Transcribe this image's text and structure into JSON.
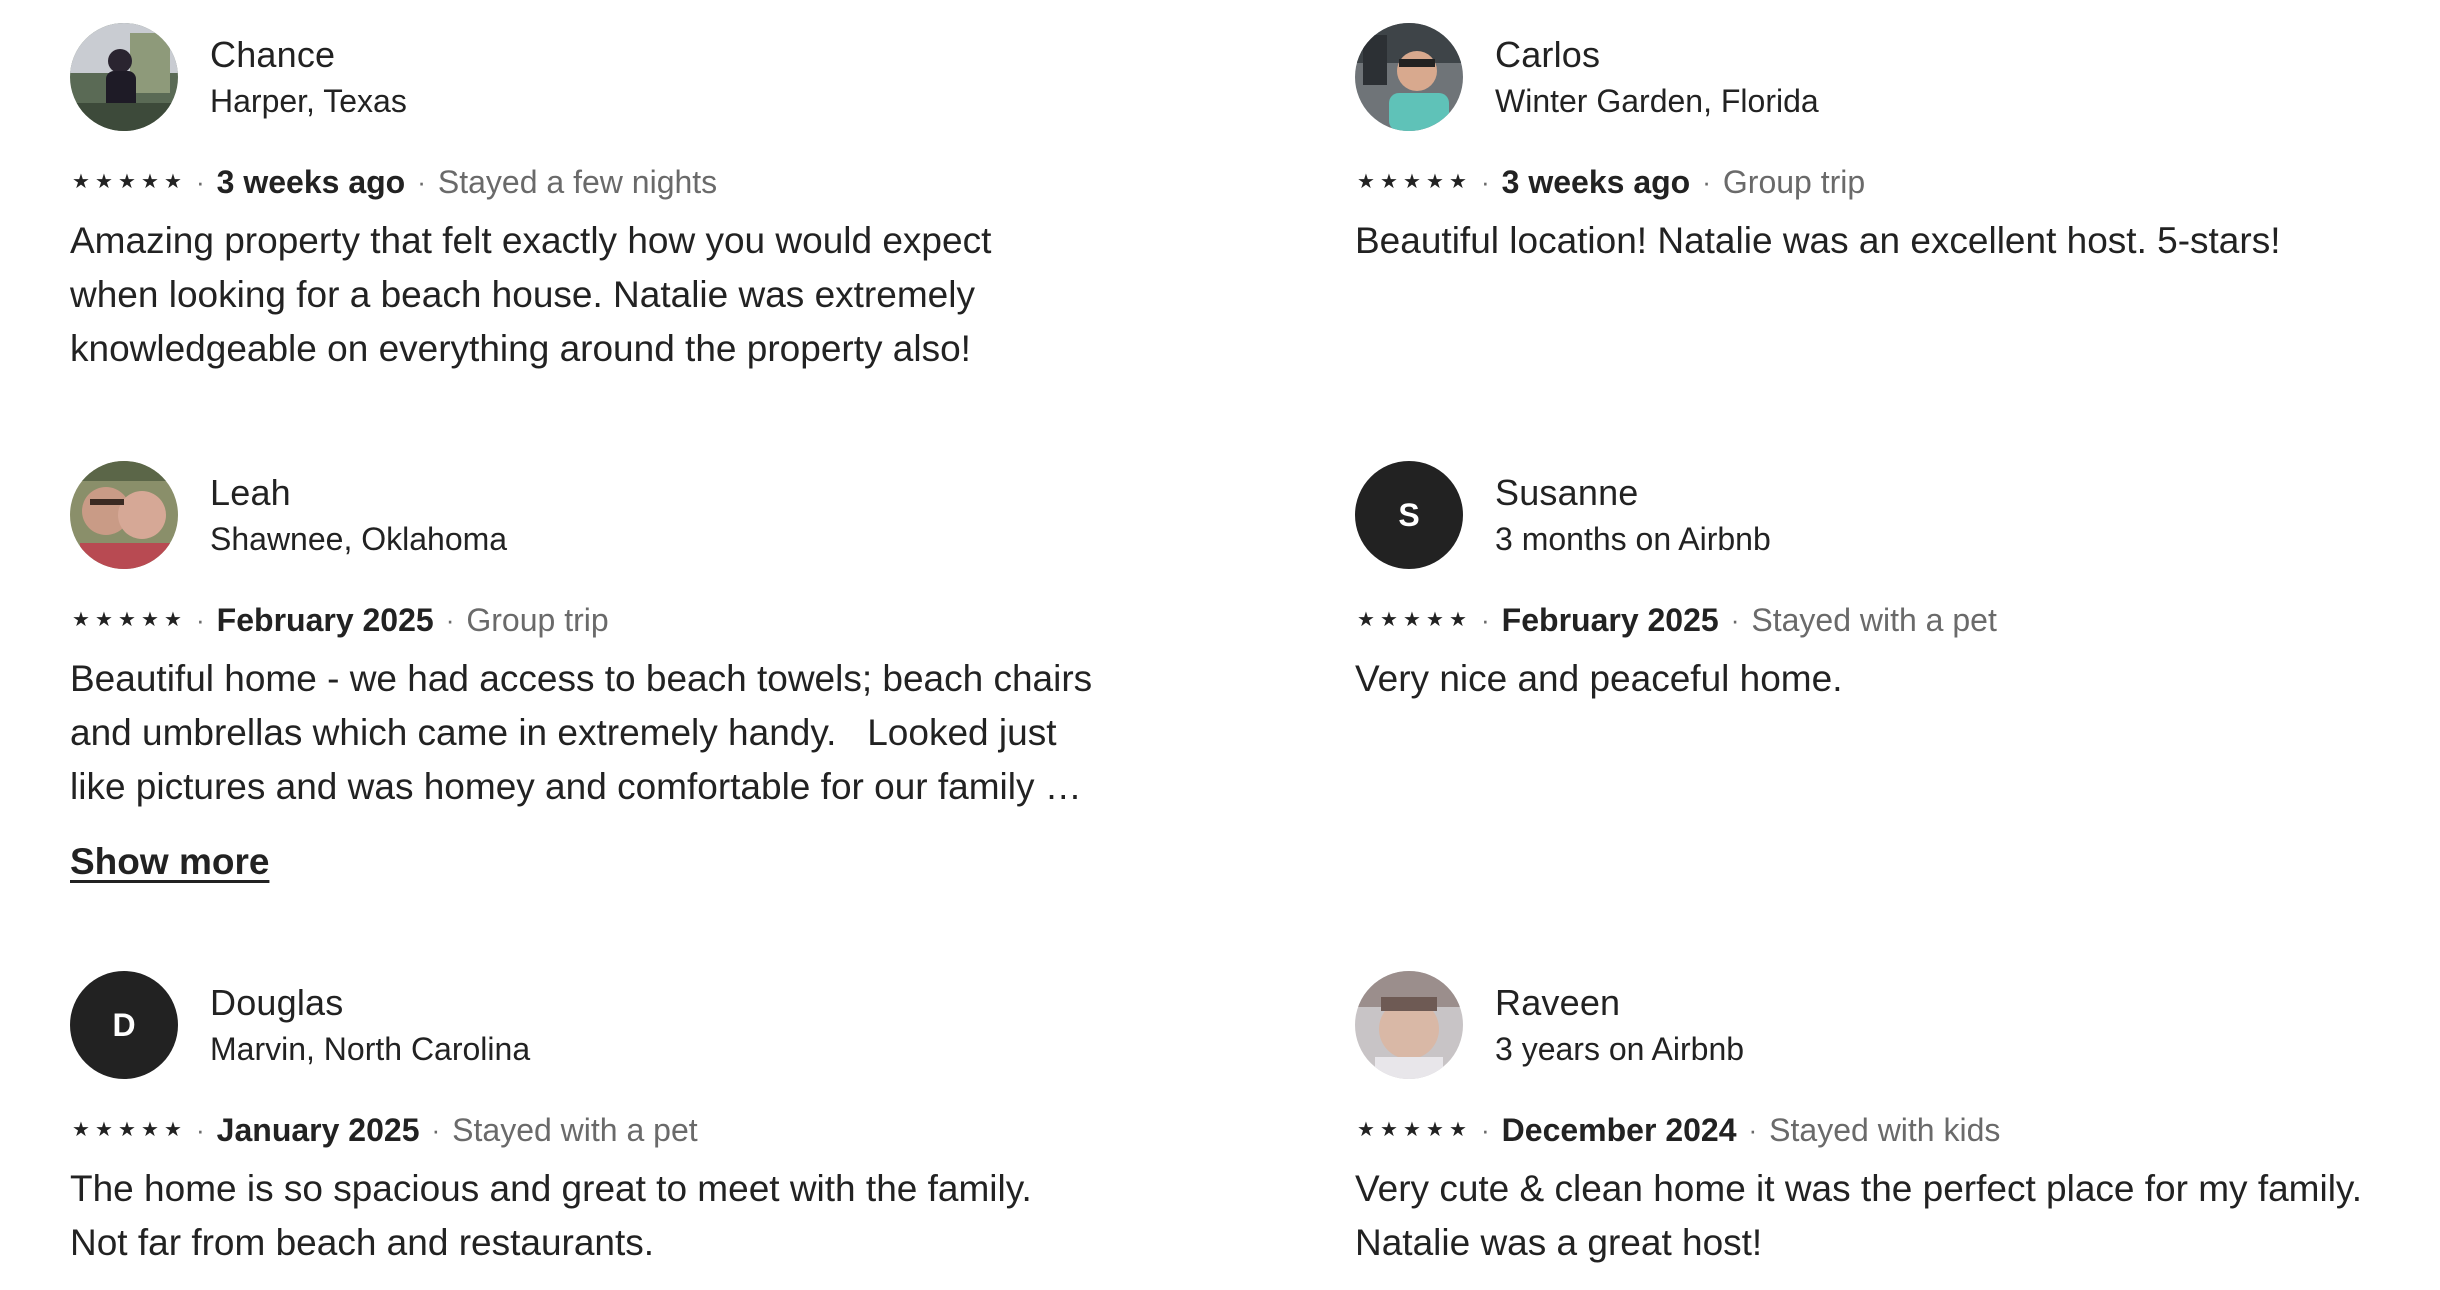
{
  "reviews": [
    {
      "name": "Chance",
      "location": "Harper, Texas",
      "rating": 5,
      "date": "3 weeks ago",
      "trip_type": "Stayed a few nights",
      "text": "Amazing property that felt exactly how you would expect\nwhen looking for a beach house. Natalie was extremely\nknowledgeable on everything around the property also!",
      "avatar": "photo-avatar"
    },
    {
      "name": "Carlos",
      "location": "Winter Garden, Florida",
      "rating": 5,
      "date": "3 weeks ago",
      "trip_type": "Group trip",
      "text": "Beautiful location! Natalie was an excellent host. 5-stars!",
      "avatar": "photo-avatar"
    },
    {
      "name": "Leah",
      "location": "Shawnee, Oklahoma",
      "rating": 5,
      "date": "February 2025",
      "trip_type": "Group trip",
      "text": "Beautiful home - we had access to beach towels; beach chairs\nand umbrellas which came in extremely handy.   Looked just\nlike pictures and was homey and comfortable for our family …",
      "show_more": "Show more",
      "avatar": "photo-avatar"
    },
    {
      "name": "Susanne",
      "location": "3 months on Airbnb",
      "rating": 5,
      "date": "February 2025",
      "trip_type": "Stayed with a pet",
      "text": "Very nice and peaceful home.",
      "avatar_letter": "S"
    },
    {
      "name": "Douglas",
      "location": "Marvin, North Carolina",
      "rating": 5,
      "date": "January 2025",
      "trip_type": "Stayed with a pet",
      "text": "The home is so spacious and great to meet with the family.\nNot far from beach and restaurants.",
      "avatar_letter": "D"
    },
    {
      "name": "Raveen",
      "location": "3 years on Airbnb",
      "rating": 5,
      "date": "December 2024",
      "trip_type": "Stayed with kids",
      "text": "Very cute & clean home it was the perfect place for my family.\nNatalie was a great host!",
      "avatar": "photo-avatar"
    }
  ],
  "separator": "·",
  "star_glyph": "★",
  "colors": {
    "text_primary": "#222222",
    "text_secondary": "#6a6a6a",
    "letter_avatar_bg": "#222222"
  }
}
